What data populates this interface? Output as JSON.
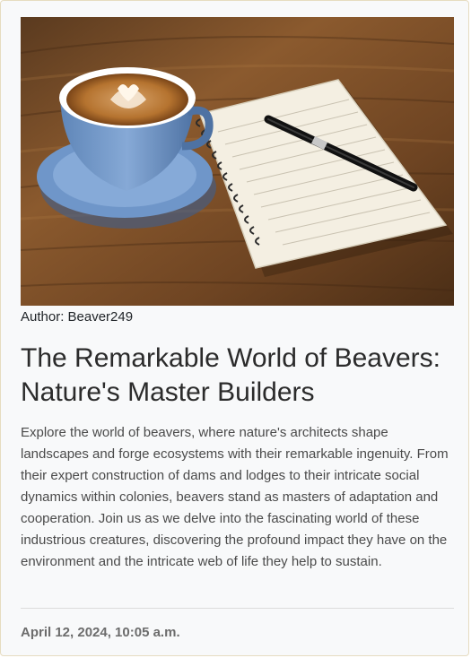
{
  "post": {
    "author": "Author: Beaver249",
    "title": "The Remarkable World of Beavers: Nature's Master Builders",
    "description": "Explore the world of beavers, where nature's architects shape landscapes and forge ecosystems with their remarkable ingenuity. From their expert construction of dams and lodges to their intricate social dynamics within colonies, beavers stand as masters of adaptation and cooperation. Join us as we delve into the fascinating world of these industrious creatures, discovering the profound impact they have on the environment and the intricate web of life they help to sustain.",
    "date": "April 12, 2024, 10:05 a.m."
  },
  "image": {
    "icon": "coffee-notebook-photo"
  }
}
